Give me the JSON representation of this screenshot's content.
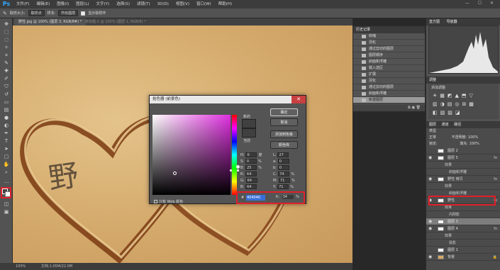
{
  "app": {
    "logo": "Ps"
  },
  "menu": [
    "文件(F)",
    "编辑(E)",
    "图像(I)",
    "图层(L)",
    "文字(Y)",
    "选择(S)",
    "滤镜(T)",
    "3D(D)",
    "视图(V)",
    "窗口(W)",
    "帮助(H)"
  ],
  "window_controls": "— ☐ ✕",
  "options": {
    "sample_size_label": "取样大小:",
    "sample_size": "取样点",
    "sample_label": "样本:",
    "sample_value": "所有图层",
    "show_ring": "显示取样环"
  },
  "document_tab": {
    "active": "野性.jpg @ 100% (图层 3, RGB/8#) *",
    "inactive": "未标题-1 @ 100% (图层 1, RGB/8) *"
  },
  "status": {
    "zoom": "100%",
    "doc": "文档:1.05M/22.0M"
  },
  "history": {
    "title": "历史记录",
    "items": [
      "收缩",
      "羽化",
      "通过剪切的图层",
      "图层顺序",
      "斜面和浮雕",
      "载入选区",
      "扩展",
      "羽化",
      "通过剪切的图层",
      "斜面和浮雕",
      "新建图层"
    ],
    "selected_index": 10
  },
  "right_panels": {
    "histogram_tab": "直方图",
    "navigator_tab": "导航器",
    "adjust_tab": "调整",
    "adjust_sub": "添加调整",
    "layers_tabs": [
      "图层",
      "通道",
      "路径"
    ],
    "layer_kind": "类型",
    "blend_mode": "正常",
    "opacity_label": "不透明度:",
    "opacity": "100%",
    "lock_label": "锁定:",
    "fill_label": "填充:",
    "fill": "100%"
  },
  "layers": [
    {
      "name": "图层 2",
      "type": "layer",
      "eye": false,
      "fx": false
    },
    {
      "name": "图层 5",
      "type": "layer",
      "eye": true,
      "fx": true
    },
    {
      "name": "效果",
      "type": "fx",
      "eye": false
    },
    {
      "name": "斜面和浮雕",
      "type": "fx-sub",
      "eye": false
    },
    {
      "name": "野性 拷贝",
      "type": "layer",
      "eye": true,
      "fx": true
    },
    {
      "name": "效果",
      "type": "fx",
      "eye": false
    },
    {
      "name": "斜面和浮雕",
      "type": "fx-sub",
      "eye": false
    },
    {
      "name": "野性",
      "type": "layer",
      "eye": true,
      "fx": true
    },
    {
      "name": "效果",
      "type": "fx",
      "eye": false
    },
    {
      "name": "内阴影",
      "type": "fx-sub",
      "eye": false
    },
    {
      "name": "图层 3",
      "type": "layer",
      "eye": true,
      "fx": false,
      "selected": true
    },
    {
      "name": "图层 4",
      "type": "layer",
      "eye": true,
      "fx": true
    },
    {
      "name": "效果",
      "type": "fx",
      "eye": false
    },
    {
      "name": "投影",
      "type": "fx-sub",
      "eye": false
    },
    {
      "name": "图层 1",
      "type": "layer",
      "eye": false,
      "fx": false
    },
    {
      "name": "背景",
      "type": "layer",
      "eye": true,
      "fx": false,
      "locked": true
    }
  ],
  "picker": {
    "title": "拾色器 (前景色)",
    "new_label": "新的",
    "current_label": "当前",
    "ok": "确定",
    "cancel": "取消",
    "add_swatch": "添加到色板",
    "libraries": "颜色库",
    "only_web": "只有 Web 颜色",
    "hex_hash": "#",
    "hex": "404040",
    "fields": [
      {
        "k": "H:",
        "v": "0",
        "u": "度",
        "k2": "L:",
        "v2": "27"
      },
      {
        "k": "S:",
        "v": "0",
        "u": "%",
        "k2": "a:",
        "v2": "0"
      },
      {
        "k": "B:",
        "v": "25",
        "u": "%",
        "k2": "b:",
        "v2": "0"
      },
      {
        "k": "R:",
        "v": "64",
        "u": "",
        "k2": "C:",
        "v2": "74",
        "u2": "%"
      },
      {
        "k": "G:",
        "v": "64",
        "u": "",
        "k2": "M:",
        "v2": "71",
        "u2": "%"
      },
      {
        "k": "B:",
        "v": "64",
        "u": "",
        "k2": "Y:",
        "v2": "71",
        "u2": "%"
      }
    ],
    "k_label": "K:",
    "k_value": "34",
    "k_unit": "%"
  },
  "canvas_text": "野",
  "colors": {
    "accent_red": "#e0202a",
    "sand": "#d6a763",
    "ps_blue": "#31a8ff"
  }
}
